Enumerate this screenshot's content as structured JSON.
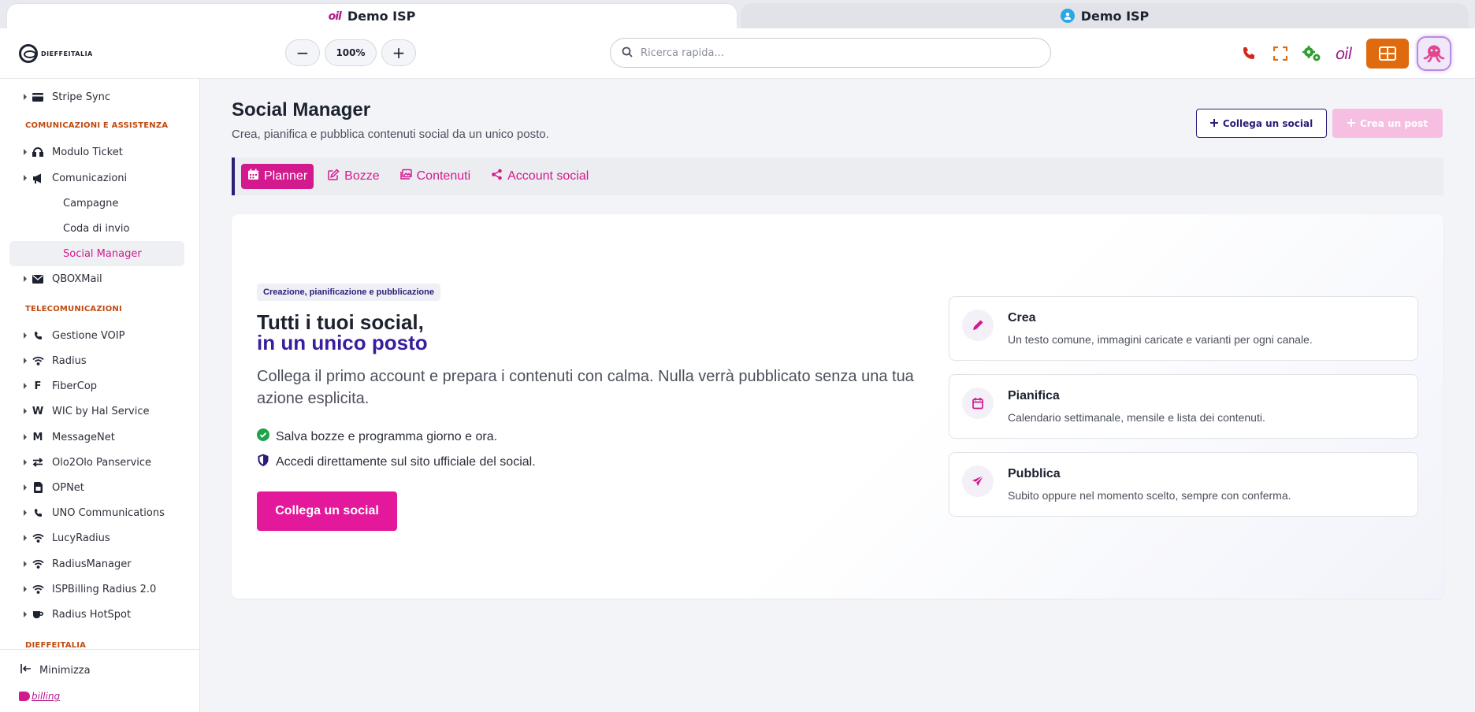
{
  "window_tabs": [
    {
      "title": "Demo ISP",
      "logo": "oil"
    },
    {
      "title": "Demo ISP"
    }
  ],
  "toolbar": {
    "brand_text": "DIEFFEITALIA",
    "zoom_out": "−",
    "zoom_value": "100%",
    "zoom_in": "+",
    "search_placeholder": "Ricerca rapida...",
    "brand_oil": "oil",
    "accent_orange": "#e06b0f"
  },
  "sidebar": {
    "items": [
      {
        "label": "Stripe Sync",
        "icon": "credit-card-icon"
      },
      {
        "section": "COMUNICAZIONI E ASSISTENZA"
      },
      {
        "label": "Modulo Ticket",
        "icon": "headset-icon"
      },
      {
        "label": "Comunicazioni",
        "icon": "megaphone-icon"
      },
      {
        "label": "Campagne"
      },
      {
        "label": "Coda di invio"
      },
      {
        "label": "Social Manager",
        "active": true
      },
      {
        "label": "QBOXMail",
        "icon": "envelope-icon"
      },
      {
        "section": "TELECOMUNICAZIONI"
      },
      {
        "label": "Gestione VOIP",
        "icon": "phone-icon"
      },
      {
        "label": "Radius",
        "icon": "wifi-icon"
      },
      {
        "label": "FiberCop",
        "icon": "F"
      },
      {
        "label": "WIC by Hal Service",
        "icon": "W"
      },
      {
        "label": "MessageNet",
        "icon": "M"
      },
      {
        "label": "Olo2Olo Panservice",
        "icon": "exchange-icon"
      },
      {
        "label": "OPNet",
        "icon": "sim-card-icon"
      },
      {
        "label": "UNO Communications",
        "icon": "phone-icon"
      },
      {
        "label": "LucyRadius",
        "icon": "wifi-icon"
      },
      {
        "label": "RadiusManager",
        "icon": "wifi-icon"
      },
      {
        "label": "ISPBilling Radius 2.0",
        "icon": "wifi-icon"
      },
      {
        "label": "Radius HotSpot",
        "icon": "coffee-icon"
      },
      {
        "section": "DIEFFEITALIA"
      }
    ],
    "minimize_label": "Minimizza",
    "billing_label": "billing"
  },
  "main": {
    "title": "Social Manager",
    "subtitle": "Crea, pianifica e pubblica contenuti social da un unico posto.",
    "connect_button": "Collega un social",
    "create_post_button": "Crea un post",
    "tabs": [
      {
        "label": "Planner",
        "active": true,
        "icon": "calendar-icon"
      },
      {
        "label": "Bozze",
        "icon": "edit-icon"
      },
      {
        "label": "Contenuti",
        "icon": "images-icon"
      },
      {
        "label": "Account social",
        "icon": "share-icon"
      }
    ],
    "hero": {
      "badge": "Creazione, pianificazione e pubblicazione",
      "title_line1": "Tutti i tuoi social,",
      "title_line2": "in un unico posto",
      "description": "Collega il primo account e prepara i contenuti con calma. Nulla verrà pubblicato senza una tua azione esplicita.",
      "bullets": [
        {
          "text": "Salva bozze e programma giorno e ora.",
          "icon": "check-circle-icon"
        },
        {
          "text": "Accedi direttamente sul sito ufficiale del social.",
          "icon": "shield-icon"
        }
      ],
      "cta": "Collega un social"
    },
    "features": [
      {
        "title": "Crea",
        "desc": "Un testo comune, immagini caricate e varianti per ogni canale.",
        "icon": "pencil-icon"
      },
      {
        "title": "Pianifica",
        "desc": "Calendario settimanale, mensile e lista dei contenuti.",
        "icon": "calendar-icon"
      },
      {
        "title": "Pubblica",
        "desc": "Subito oppure nel momento scelto, sempre con conferma.",
        "icon": "paper-plane-icon"
      }
    ],
    "accent_pink": "#d3198e",
    "accent_indigo": "#2b1c78"
  }
}
